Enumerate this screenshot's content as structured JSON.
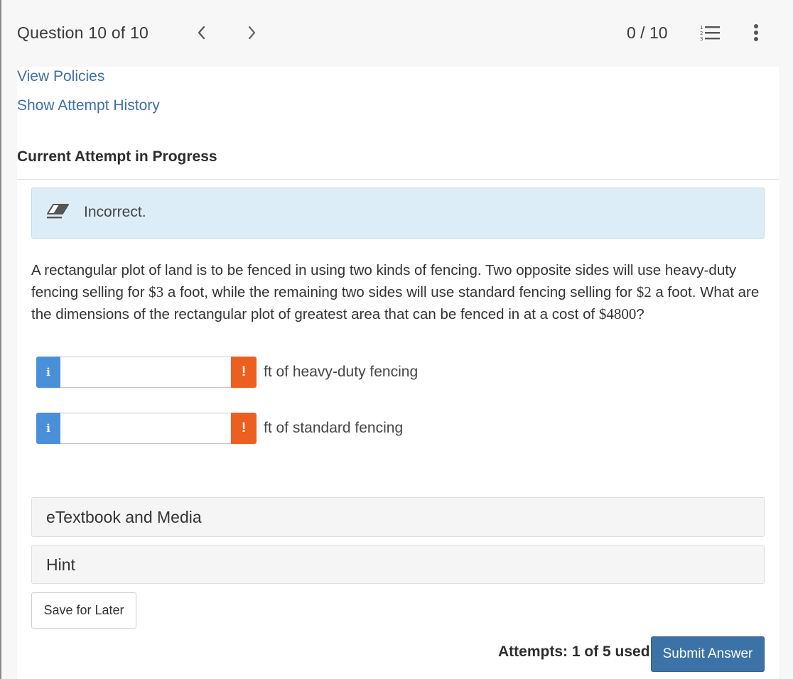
{
  "header": {
    "question_counter": "Question 10 of 10",
    "prev_icon": "chevron-left-icon",
    "next_icon": "chevron-right-icon",
    "score": "0 / 10",
    "list_icon": "numbered-list-icon",
    "more_icon": "more-vertical-icon"
  },
  "links": {
    "view_policies": "View Policies",
    "attempt_history": "Show Attempt History"
  },
  "attempt_heading": "Current Attempt in Progress",
  "feedback": {
    "icon": "eraser-icon",
    "text": "Incorrect.",
    "background": "#ddedf8"
  },
  "question": {
    "part1": "A rectangular plot of land is to be fenced in using two kinds of fencing. Two opposite sides will use heavy-duty fencing selling for ",
    "price1": "$3",
    "part2": " a foot, while the remaining two sides will use standard fencing selling for ",
    "price2": "$2",
    "part3": " a foot. What are the dimensions of the rectangular plot of greatest area that can be fenced in at a cost of ",
    "total": "$4800",
    "part4": "?"
  },
  "answers": [
    {
      "info_label": "i",
      "value": "",
      "warning_label": "!",
      "unit": "ft of heavy-duty fencing"
    },
    {
      "info_label": "i",
      "value": "",
      "warning_label": "!",
      "unit": "ft of standard fencing"
    }
  ],
  "accordions": {
    "etextbook": "eTextbook and Media",
    "hint": "Hint"
  },
  "footer": {
    "save_label": "Save for Later",
    "attempts": "Attempts: 1 of 5 used",
    "submit_label": "Submit Answer"
  },
  "colors": {
    "info_button": "#4a90d9",
    "warning_button": "#ec5f1e",
    "submit_button": "#3b72a8",
    "link": "#3d6fa8"
  }
}
